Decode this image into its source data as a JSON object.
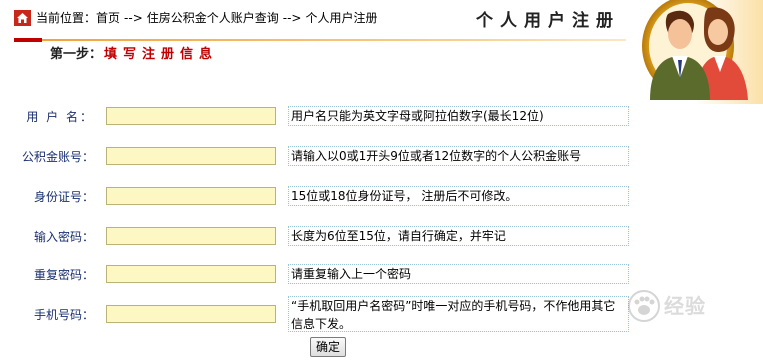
{
  "breadcrumb": {
    "prefix": "当前位置：",
    "home": "首页",
    "sep1": "-->",
    "item1": "住房公积金个人账户查询",
    "sep2": "-->",
    "item2": "个人用户注册"
  },
  "page_title": "个人用户注册",
  "step": {
    "prefix": "第一步：",
    "text": "填写注册信息"
  },
  "form": {
    "fields": [
      {
        "label": "用  户  名：",
        "value": "",
        "hint": "用户名只能为英文字母或阿拉伯数字(最长12位)"
      },
      {
        "label": "公积金账号：",
        "value": "",
        "hint": "请输入以0或1开头9位或者12位数字的个人公积金账号"
      },
      {
        "label": "身份证号：",
        "value": "",
        "hint": "15位或18位身份证号，  注册后不可修改。"
      },
      {
        "label": "输入密码：",
        "value": "",
        "hint": "长度为6位至15位，请自行确定，并牢记"
      },
      {
        "label": "重复密码：",
        "value": "",
        "hint": "请重复输入上一个密码"
      },
      {
        "label": "手机号码：",
        "value": "",
        "hint": "“手机取回用户名密码”时唯一对应的手机号码，不作他用其它信息下发。"
      }
    ],
    "submit_label": "确定"
  },
  "watermark": {
    "text": "经验"
  },
  "icons": {
    "home": "home-icon",
    "avatar": "user-couple-avatar-icon"
  },
  "colors": {
    "accent_red": "#c00000",
    "accent_orange": "#f2a33a",
    "input_bg": "#fdf8c3",
    "label_blue": "#1a2f6f"
  }
}
